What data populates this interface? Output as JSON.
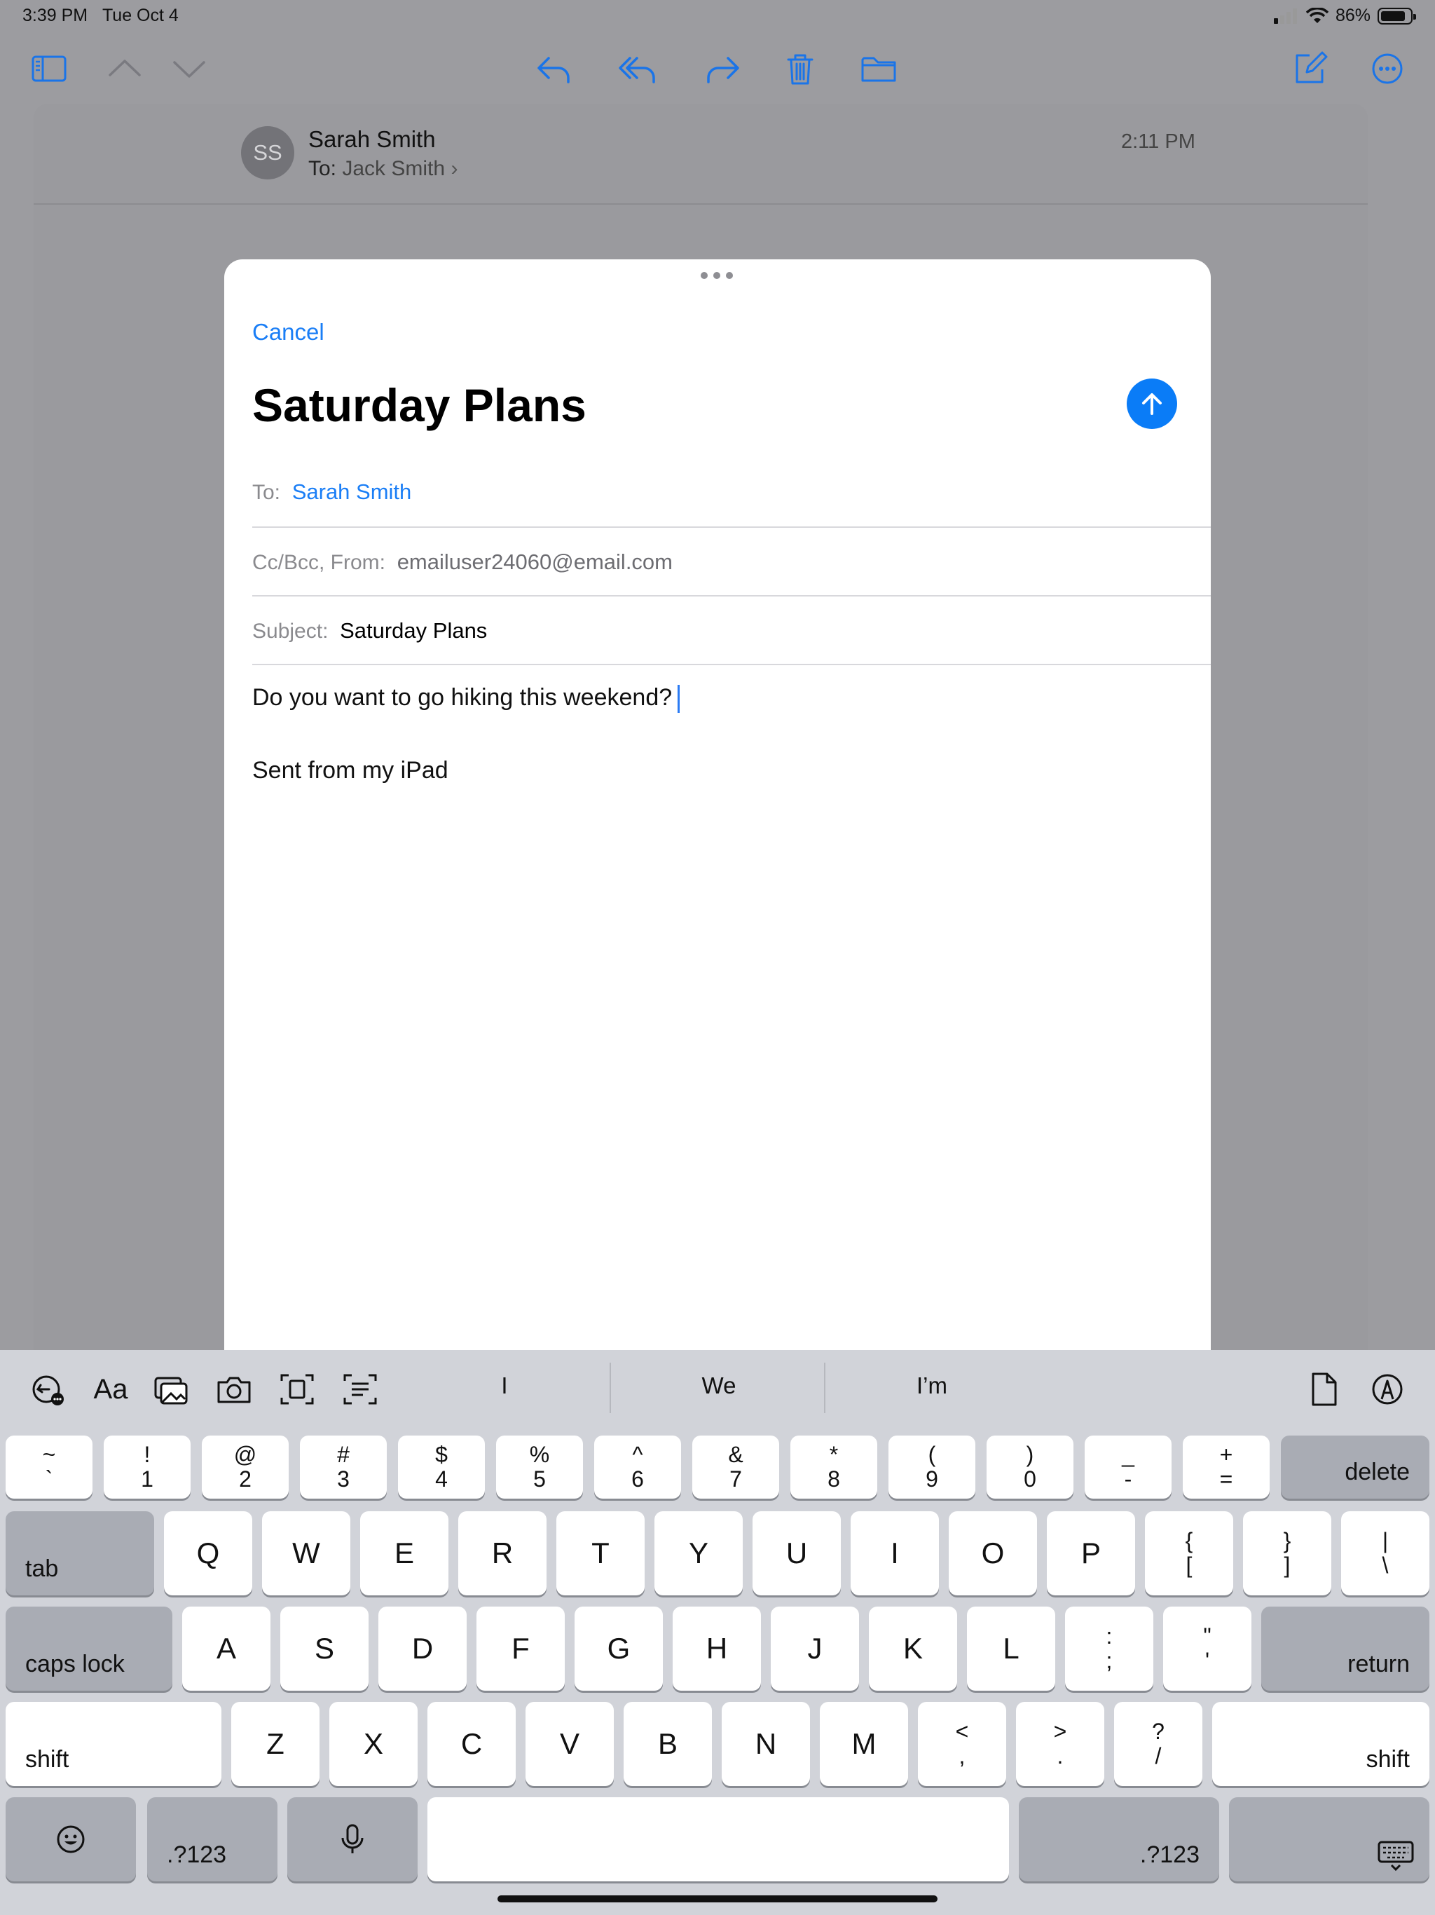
{
  "status": {
    "time": "3:39 PM",
    "date": "Tue Oct 4",
    "battery": "86%",
    "battery_level": 0.86
  },
  "toolbar": {
    "icons": [
      "sidebar-icon",
      "chevron-up-icon",
      "chevron-down-icon",
      "reply-icon",
      "reply-all-icon",
      "forward-icon",
      "trash-icon",
      "folder-icon",
      "compose-icon",
      "more-icon"
    ]
  },
  "message": {
    "avatar_initials": "SS",
    "sender": "Sarah Smith",
    "to_label": "To:",
    "to_name": "Jack Smith",
    "time": "2:11 PM"
  },
  "compose": {
    "cancel": "Cancel",
    "title": "Saturday Plans",
    "to_label": "To:",
    "to_value": "Sarah Smith",
    "ccbcc_label": "Cc/Bcc, From:",
    "from_value": "emailuser24060@email.com",
    "subject_label": "Subject:",
    "subject_value": "Saturday Plans",
    "body": "Do you want to go hiking this weekend?",
    "signature": "Sent from my iPad"
  },
  "keyboard": {
    "suggestions": [
      "I",
      "We",
      "I’m"
    ],
    "shortcuts": [
      "undo-icon",
      "Aa",
      "photo-library-icon",
      "camera-icon",
      "scan-document-icon",
      "scan-text-icon",
      "document-icon",
      "markup-icon"
    ],
    "row1": [
      {
        "top": "~",
        "bottom": "`"
      },
      {
        "top": "!",
        "bottom": "1"
      },
      {
        "top": "@",
        "bottom": "2"
      },
      {
        "top": "#",
        "bottom": "3"
      },
      {
        "top": "$",
        "bottom": "4"
      },
      {
        "top": "%",
        "bottom": "5"
      },
      {
        "top": "^",
        "bottom": "6"
      },
      {
        "top": "&",
        "bottom": "7"
      },
      {
        "top": "*",
        "bottom": "8"
      },
      {
        "top": "(",
        "bottom": "9"
      },
      {
        "top": ")",
        "bottom": "0"
      },
      {
        "top": "_",
        "bottom": "-"
      },
      {
        "top": "+",
        "bottom": "="
      }
    ],
    "delete": "delete",
    "tab": "tab",
    "row2": [
      "Q",
      "W",
      "E",
      "R",
      "T",
      "Y",
      "U",
      "I",
      "O",
      "P"
    ],
    "row2_sym": [
      {
        "top": "{",
        "bottom": "["
      },
      {
        "top": "}",
        "bottom": "]"
      },
      {
        "top": "|",
        "bottom": "\\"
      }
    ],
    "caps": "caps lock",
    "row3": [
      "A",
      "S",
      "D",
      "F",
      "G",
      "H",
      "J",
      "K",
      "L"
    ],
    "row3_sym": [
      {
        "top": ":",
        "bottom": ";"
      },
      {
        "top": "\"",
        "bottom": "'"
      }
    ],
    "return": "return",
    "shift": "shift",
    "row4": [
      "Z",
      "X",
      "C",
      "V",
      "B",
      "N",
      "M"
    ],
    "row4_sym": [
      {
        "top": "<",
        "bottom": ","
      },
      {
        "top": ">",
        "bottom": "."
      },
      {
        "top": "?",
        "bottom": "/"
      }
    ],
    "numbers": ".?123"
  }
}
